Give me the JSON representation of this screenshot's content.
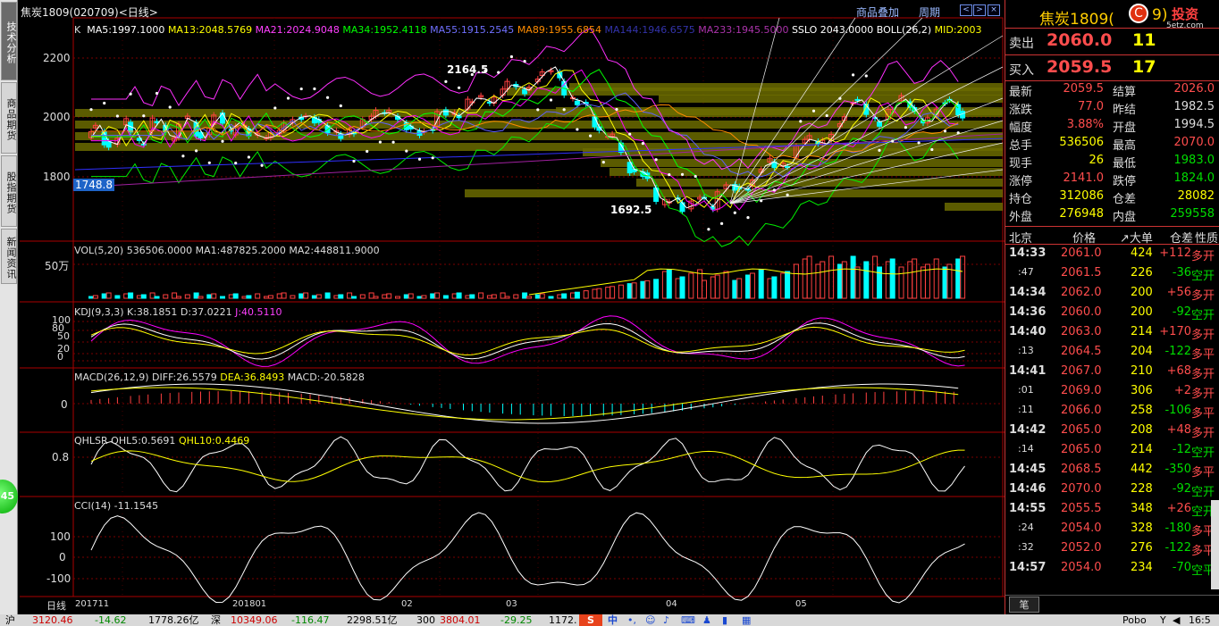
{
  "title": "焦炭1809(020709)<日线>",
  "toolbar": {
    "overlay": "商品叠加",
    "period": "周期"
  },
  "left_tabs": [
    "技术分析",
    "商品期货",
    "股指期货",
    "新闻资讯"
  ],
  "green_button": "45",
  "ma_legend": {
    "k": "K",
    "ma5": "MA5:1997.1000",
    "ma13": "MA13:2048.5769",
    "ma21": "MA21:2024.9048",
    "ma34": "MA34:1952.4118",
    "ma55": "MA55:1915.2545",
    "ma89": "MA89:1955.6854",
    "ma144": "MA144:1946.6575",
    "ma233": "MA233:1945.5000",
    "sslo": "SSLO 2043.0000",
    "boll": "BOLL(26,2)",
    "mid": "MID:2003"
  },
  "price_axis": [
    "2200",
    "2000",
    "1800"
  ],
  "price_marker": "1748.8",
  "annot_high": "2164.5",
  "annot_low": "1692.5",
  "vol": {
    "legend": "VOL(5,20) 536506.0000 MA1:487825.2000 MA2:448811.9000",
    "axis": "50万"
  },
  "kdj": {
    "legend_main": "KDJ(9,3,3) K:38.1851 D:37.0221",
    "legend_j": "J:40.5110",
    "axis": [
      "100",
      "80",
      "50",
      "20",
      "0"
    ]
  },
  "macd": {
    "legend_main": "MACD(26,12,9) DIFF:26.5579",
    "legend_dea": "DEA:36.8493",
    "legend_macd": "MACD:-20.5828",
    "axis": "0"
  },
  "qhlsr": {
    "legend_main": "QHLSR QHL5:0.5691",
    "legend_b": "QHL10:0.4469",
    "axis": "0.8"
  },
  "cci": {
    "legend": "CCI(14) -11.1545",
    "axis": [
      "100",
      "0",
      "-100"
    ]
  },
  "x_axis": [
    "日线",
    "201711",
    "201801",
    "02",
    "03",
    "04",
    "05"
  ],
  "quote": {
    "name": "焦炭1809(",
    "name_tail": "9)",
    "sell_label": "卖出",
    "sell_price": "2060.0",
    "sell_vol": "11",
    "buy_label": "买入",
    "buy_price": "2059.5",
    "buy_vol": "17",
    "rows": [
      [
        "最新",
        "2059.5",
        "结算",
        "2026.0"
      ],
      [
        "涨跌",
        "77.0",
        "昨结",
        "1982.5"
      ],
      [
        "幅度",
        "3.88%",
        "开盘",
        "1994.5"
      ],
      [
        "总手",
        "536506",
        "最高",
        "2070.0"
      ],
      [
        "现手",
        "26",
        "最低",
        "1983.0"
      ],
      [
        "涨停",
        "2141.0",
        "跌停",
        "1824.0"
      ],
      [
        "持仓",
        "312086",
        "仓差",
        "28082"
      ],
      [
        "外盘",
        "276948",
        "内盘",
        "259558"
      ]
    ],
    "tick_header": [
      "北京",
      "价格",
      "↗大单",
      "仓差",
      "性质"
    ],
    "ticks": [
      [
        "14:33",
        "2061.0",
        "424",
        "+112",
        "多开"
      ],
      [
        ":47",
        "2061.5",
        "226",
        "-36",
        "空开"
      ],
      [
        "14:34",
        "2062.0",
        "200",
        "+56",
        "多开"
      ],
      [
        "14:36",
        "2060.0",
        "200",
        "-92",
        "空开"
      ],
      [
        "14:40",
        "2063.0",
        "214",
        "+170",
        "多开"
      ],
      [
        ":13",
        "2064.5",
        "204",
        "-122",
        "多平"
      ],
      [
        "14:41",
        "2067.0",
        "210",
        "+68",
        "多开"
      ],
      [
        ":01",
        "2069.0",
        "306",
        "+2",
        "多开"
      ],
      [
        ":11",
        "2066.0",
        "258",
        "-106",
        "多平"
      ],
      [
        "14:42",
        "2065.0",
        "208",
        "+48",
        "多开"
      ],
      [
        ":14",
        "2065.0",
        "214",
        "-12",
        "空开"
      ],
      [
        "14:45",
        "2068.5",
        "442",
        "-350",
        "多平"
      ],
      [
        "14:46",
        "2070.0",
        "228",
        "-92",
        "空开"
      ],
      [
        "14:55",
        "2055.5",
        "348",
        "+26",
        "空开"
      ],
      [
        ":24",
        "2054.0",
        "328",
        "-180",
        "多平"
      ],
      [
        ":32",
        "2052.0",
        "276",
        "-122",
        "多平"
      ],
      [
        "14:57",
        "2054.0",
        "234",
        "-70",
        "空平"
      ]
    ],
    "bottom_tab": "笔",
    "logo": "投资",
    "logo_sub": "5etz.com"
  },
  "status": {
    "sh": "沪",
    "sh_val": "3120.46",
    "sh_chg": "-14.62",
    "sh_amt": "1778.26亿",
    "sz": "深",
    "sz_val": "10349.06",
    "sz_chg": "-116.47",
    "sz_amt": "2298.51亿",
    "c300": "300",
    "c300_val": "3804.01",
    "c300_chg": "-29.25",
    "c300_amt": "1172.",
    "ime": "中",
    "right": "Pobo",
    "time": "16:5"
  },
  "colors": {
    "up": "#ff4040",
    "down": "#00ffff",
    "ma5": "#ffffff",
    "ma13": "#ffff00",
    "ma21": "#ff00ff",
    "ma34": "#00ff00",
    "ma55": "#6060ff",
    "ma89": "#ff8c00",
    "grid": "#8b0000"
  }
}
